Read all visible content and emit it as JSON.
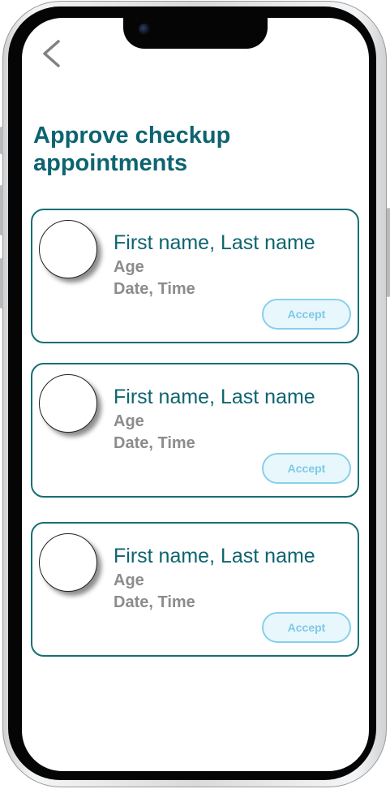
{
  "header": {
    "back_icon": "chevron-left-icon",
    "title": "Approve checkup appointments"
  },
  "appointments": [
    {
      "name": "First name, Last name",
      "age": "Age",
      "datetime": "Date, Time",
      "accept_label": "Accept"
    },
    {
      "name": "First name, Last name",
      "age": "Age",
      "datetime": "Date, Time",
      "accept_label": "Accept"
    },
    {
      "name": "First name, Last name",
      "age": "Age",
      "datetime": "Date, Time",
      "accept_label": "Accept"
    }
  ],
  "colors": {
    "accent": "#0d6470",
    "card_border": "#166f73",
    "secondary_text": "#8c8c8c",
    "button_border": "#88d0ec",
    "button_bg": "#e8f7fc"
  }
}
